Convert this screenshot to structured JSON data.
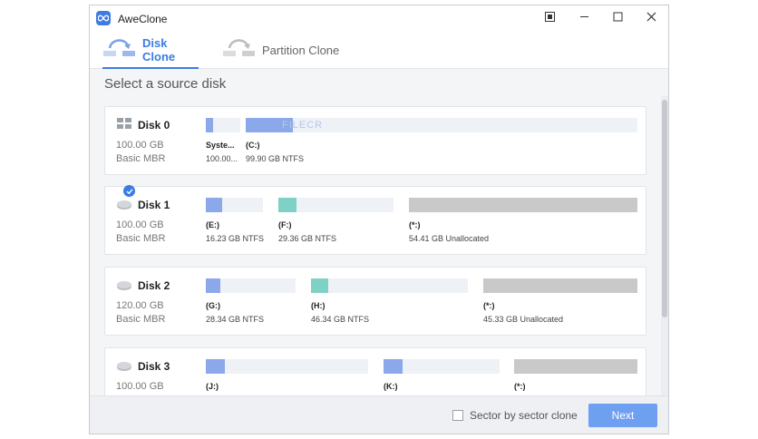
{
  "window": {
    "title": "AweClone",
    "accent": "#3d7ce0",
    "tabs": [
      {
        "label": "Disk Clone",
        "active": true
      },
      {
        "label": "Partition Clone",
        "active": false
      }
    ]
  },
  "heading": "Select a source disk",
  "watermark": "FILECR",
  "disks": [
    {
      "name": "Disk 0",
      "size": "100.00 GB",
      "type": "Basic MBR",
      "selected": false,
      "partitions": [
        {
          "label": "Syste...",
          "info": "100.00...",
          "kind": "system",
          "color": "#8aa8ea",
          "fill": 1.0
        },
        {
          "label": "(C:)",
          "info": "99.90 GB NTFS",
          "kind": "ntfs",
          "color": "#8aa8ea",
          "fill": 0.13
        }
      ]
    },
    {
      "name": "Disk 1",
      "size": "100.00 GB",
      "type": "Basic MBR",
      "selected": true,
      "partitions": [
        {
          "label": "(E:)",
          "info": "16.23 GB NTFS",
          "kind": "ntfs",
          "color": "#8aa8ea",
          "fill": 0.28
        },
        {
          "label": "(F:)",
          "info": "29.36 GB NTFS",
          "kind": "ntfs",
          "color": "#7fd1c5",
          "fill": 0.16
        },
        {
          "label": "(*:)",
          "info": "54.41 GB Unallocated",
          "kind": "unallocated",
          "color": "#c9c9c9",
          "fill": 0
        }
      ]
    },
    {
      "name": "Disk 2",
      "size": "120.00 GB",
      "type": "Basic MBR",
      "selected": false,
      "partitions": [
        {
          "label": "(G:)",
          "info": "28.34 GB NTFS",
          "kind": "ntfs",
          "color": "#8aa8ea",
          "fill": 0.16
        },
        {
          "label": "(H:)",
          "info": "46.34 GB NTFS",
          "kind": "ntfs",
          "color": "#7fd1c5",
          "fill": 0.11
        },
        {
          "label": "(*:)",
          "info": "45.33 GB Unallocated",
          "kind": "unallocated",
          "color": "#c9c9c9",
          "fill": 0
        }
      ]
    },
    {
      "name": "Disk 3",
      "size": "100.00 GB",
      "type": "",
      "selected": false,
      "partitions": [
        {
          "label": "(J:)",
          "info": "",
          "kind": "ntfs",
          "color": "#8aa8ea",
          "fill": 0.12
        },
        {
          "label": "(K:)",
          "info": "",
          "kind": "ntfs",
          "color": "#8aa8ea",
          "fill": 0.16
        },
        {
          "label": "(*:)",
          "info": "",
          "kind": "unallocated",
          "color": "#c9c9c9",
          "fill": 0
        }
      ]
    }
  ],
  "footer": {
    "sector_label": "Sector by sector clone",
    "sector_checked": false,
    "next_label": "Next"
  }
}
